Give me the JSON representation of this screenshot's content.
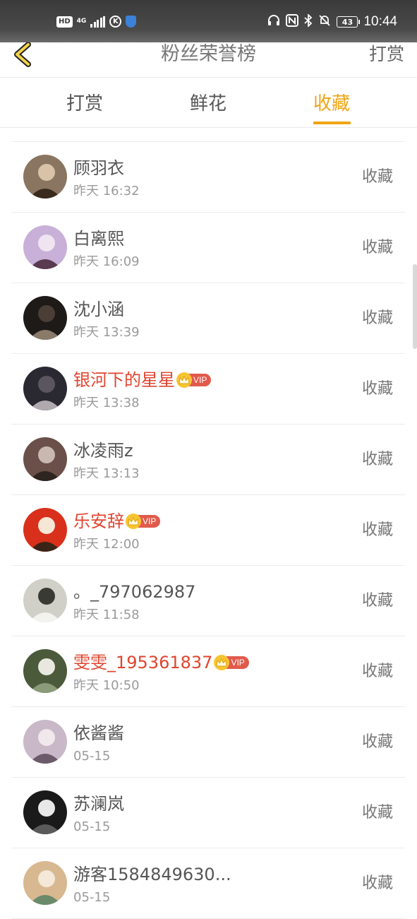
{
  "status_bar": {
    "hd": "HD",
    "network": "4G",
    "k_icon": "K",
    "battery": "43",
    "time": "10:44"
  },
  "header": {
    "title": "粉丝荣誉榜",
    "right_action": "打赏"
  },
  "tabs": [
    {
      "label": "打赏",
      "active": false
    },
    {
      "label": "鲜花",
      "active": false
    },
    {
      "label": "收藏",
      "active": true
    }
  ],
  "vip_label": "VIP",
  "colors": {
    "accent": "#f0a514",
    "vip_name": "#e0452e",
    "vip_pill": "#e25a4b",
    "crown": "#f7c531"
  },
  "fans": [
    {
      "name": "顾羽衣",
      "time": "昨天 16:32",
      "action": "收藏",
      "vip": false
    },
    {
      "name": "白离熙",
      "time": "昨天 16:09",
      "action": "收藏",
      "vip": false
    },
    {
      "name": "沈小涵",
      "time": "昨天 13:39",
      "action": "收藏",
      "vip": false
    },
    {
      "name": "银河下的星星",
      "time": "昨天 13:38",
      "action": "收藏",
      "vip": true
    },
    {
      "name": "冰凌雨z",
      "time": "昨天 13:13",
      "action": "收藏",
      "vip": false
    },
    {
      "name": "乐安辞",
      "time": "昨天 12:00",
      "action": "收藏",
      "vip": true
    },
    {
      "name": "。_797062987",
      "time": "昨天 11:58",
      "action": "收藏",
      "vip": false
    },
    {
      "name": "雯雯_195361837",
      "time": "昨天 10:50",
      "action": "收藏",
      "vip": true
    },
    {
      "name": "依酱酱",
      "time": "05-15",
      "action": "收藏",
      "vip": false
    },
    {
      "name": "苏澜岚",
      "time": "05-15",
      "action": "收藏",
      "vip": false
    },
    {
      "name": "游客1584849630...",
      "time": "05-15",
      "action": "收藏",
      "vip": false
    }
  ]
}
